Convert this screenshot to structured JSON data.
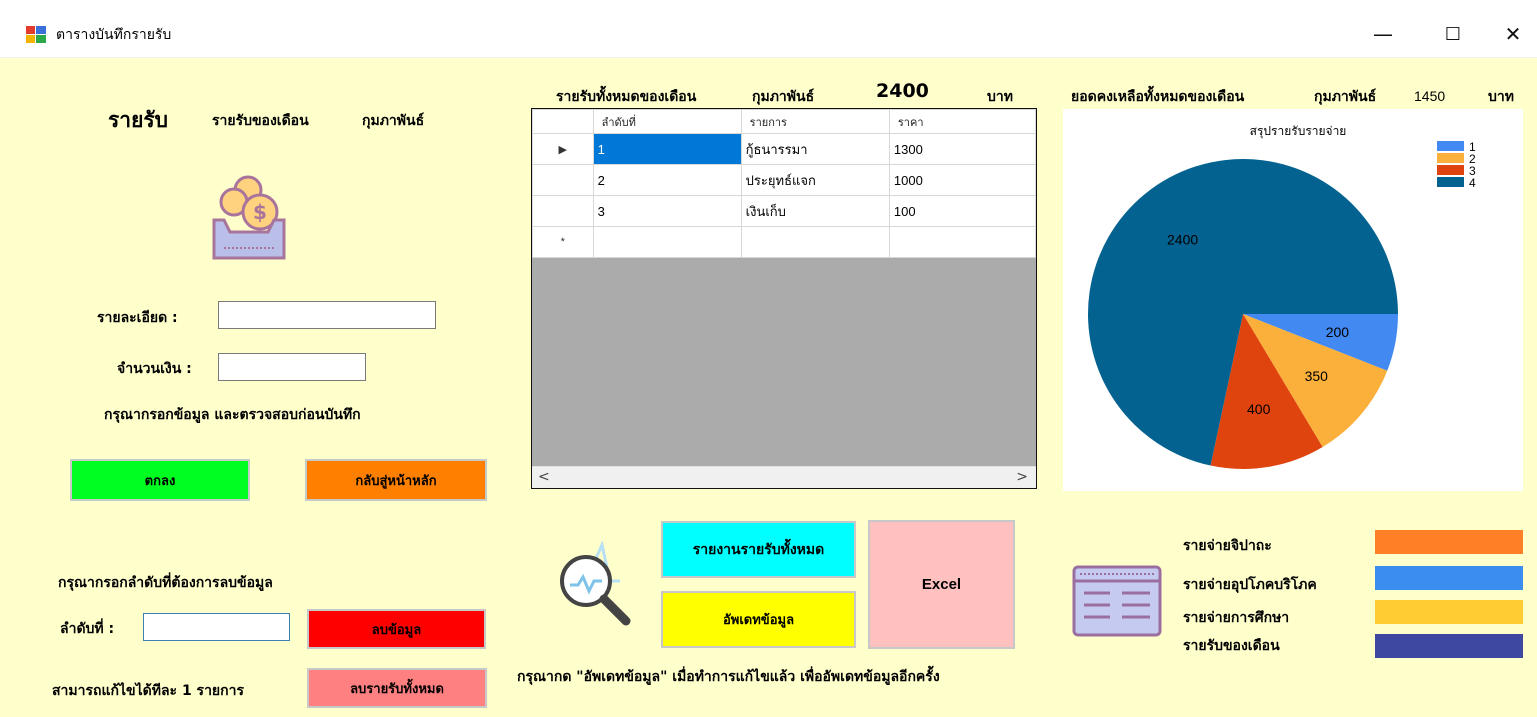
{
  "window": {
    "title": "ตารางบันทึกรายรับ",
    "minimize": "—",
    "maximize": "☐",
    "close": "✕"
  },
  "left": {
    "heading": "รายรับ",
    "month_prefix": "รายรับของเดือน",
    "month": "กุมภาพันธ์",
    "detail_label": "รายละเอียด :",
    "detail_value": "",
    "amount_label": "จำนวนเงิน :",
    "amount_value": "",
    "notice": "กรุณากรอกข้อมูล และตรวจสอบก่อนบันทึก",
    "ok_button": "ตกลง",
    "back_button": "กลับสู่หน้าหลัก",
    "delete_prompt": "กรุณากรอกลำดับที่ต้องการลบข้อมูล",
    "index_label": "ลำดับที่ :",
    "index_value": "",
    "delete_button": "ลบข้อมูล",
    "edit_note": "สามารถแก้ไขได้ทีละ 1 รายการ",
    "delete_all_button": "ลบรายรับทั้งหมด"
  },
  "summary": {
    "income_label": "รายรับทั้งหมดของเดือน",
    "income_month": "กุมภาพันธ์",
    "income_total": "2400",
    "income_unit": "บาท",
    "balance_label": "ยอดคงเหลือทั้งหมดของเดือน",
    "balance_month": "กุมภาพันธ์",
    "balance_total": "1450",
    "balance_unit": "บาท"
  },
  "grid": {
    "columns": [
      "ลำดับที่",
      "รายการ",
      "ราคา"
    ],
    "rows": [
      {
        "marker": "▶",
        "cells": [
          "1",
          "กู้ธนารรมา",
          "1300"
        ]
      },
      {
        "marker": "",
        "cells": [
          "2",
          "ประยุทธ์แจก",
          "1000"
        ]
      },
      {
        "marker": "",
        "cells": [
          "3",
          "เงินเก็บ",
          "100"
        ]
      },
      {
        "marker": "*",
        "cells": [
          "",
          "",
          ""
        ]
      }
    ],
    "scroll_left": "<",
    "scroll_right": ">"
  },
  "actions": {
    "report_button": "รายงานรายรับทั้งหมด",
    "update_button": "อัพเดทข้อมูล",
    "excel_button": "Excel",
    "update_hint": "กรุณากด \"อัพเดทข้อมูล\" เมื่อทำการแก้ไขแล้ว เพื่ออัพเดทข้อมูลอีกครั้ง"
  },
  "chart_data": {
    "type": "pie",
    "title": "สรุปรายรับรายจ่าย",
    "slices": [
      {
        "label": "1",
        "value": 200,
        "color": "#4289f2"
      },
      {
        "label": "2",
        "value": 350,
        "color": "#fbb03b"
      },
      {
        "label": "3",
        "value": 400,
        "color": "#e0440e"
      },
      {
        "label": "4",
        "value": 2400,
        "color": "#03628f"
      }
    ],
    "legend": [
      "1",
      "2",
      "3",
      "4"
    ],
    "legend_position": "top-right"
  },
  "color_key": [
    {
      "label": "รายจ่ายจิปาถะ",
      "color": "#ff7f27"
    },
    {
      "label": "รายจ่ายอุปโภคบริโภค",
      "color": "#3b8ef0"
    },
    {
      "label": "รายจ่ายการศึกษา",
      "color": "#ffcc33"
    },
    {
      "label": "รายรับของเดือน",
      "color": "#3f48a0"
    }
  ],
  "colors": {
    "ok": "#00ff21",
    "back": "#ff7f00",
    "delete": "#ff0000",
    "delete_all": "#ff8080",
    "report": "#00ffff",
    "update": "#ffff00",
    "excel": "#ffc0c0"
  }
}
